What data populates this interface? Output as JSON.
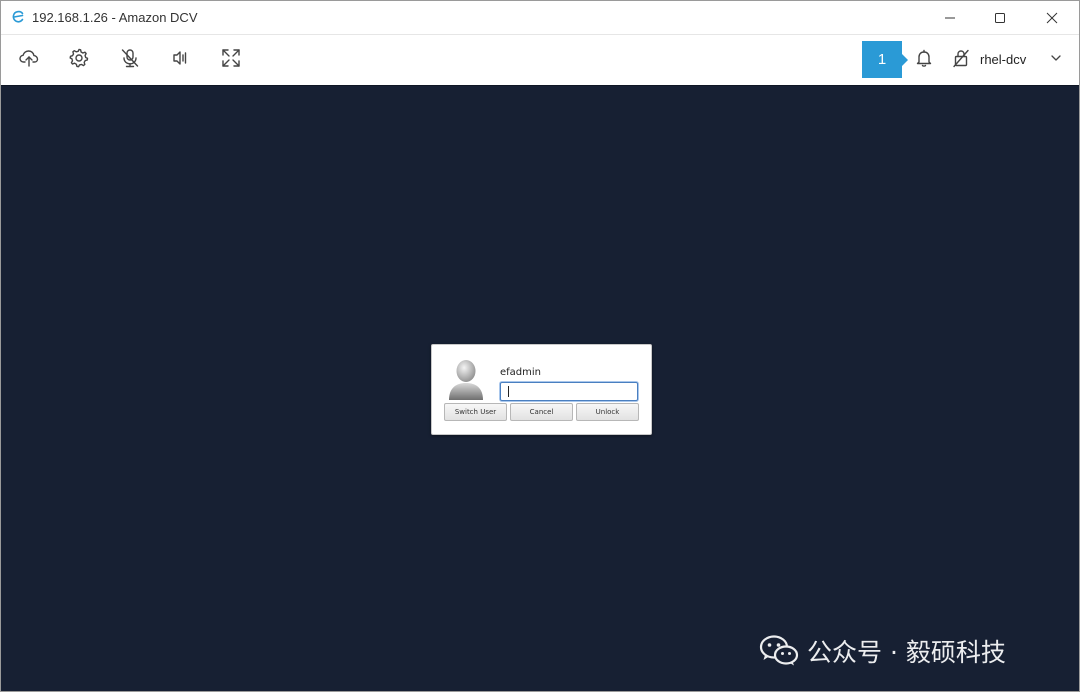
{
  "window": {
    "title": "192.168.1.26 - Amazon DCV",
    "app_icon": "dcv-e-icon",
    "controls": [
      "minimize-icon",
      "maximize-icon",
      "close-icon"
    ]
  },
  "toolbar": {
    "buttons": [
      "upload-cloud-icon",
      "gear-icon",
      "microphone-off-icon",
      "speaker-icon",
      "fullscreen-icon"
    ],
    "notification_count": "1",
    "notification_icon": "bell-icon",
    "session_icon": "lock-off-icon",
    "session_name": "rhel-dcv",
    "session_dropdown_icon": "chevron-down-icon"
  },
  "lock_dialog": {
    "avatar_icon": "user-avatar-icon",
    "username": "efadmin",
    "password_value": "",
    "buttons": {
      "switch_user": "Switch User",
      "cancel": "Cancel",
      "unlock": "Unlock"
    }
  },
  "watermark": {
    "logo": "wechat-icon",
    "text": "公众号 · 毅硕科技"
  },
  "colors": {
    "desktop_background": "#172033",
    "notification_accent": "#2a9ad6",
    "input_focus": "#4a7fc0"
  }
}
